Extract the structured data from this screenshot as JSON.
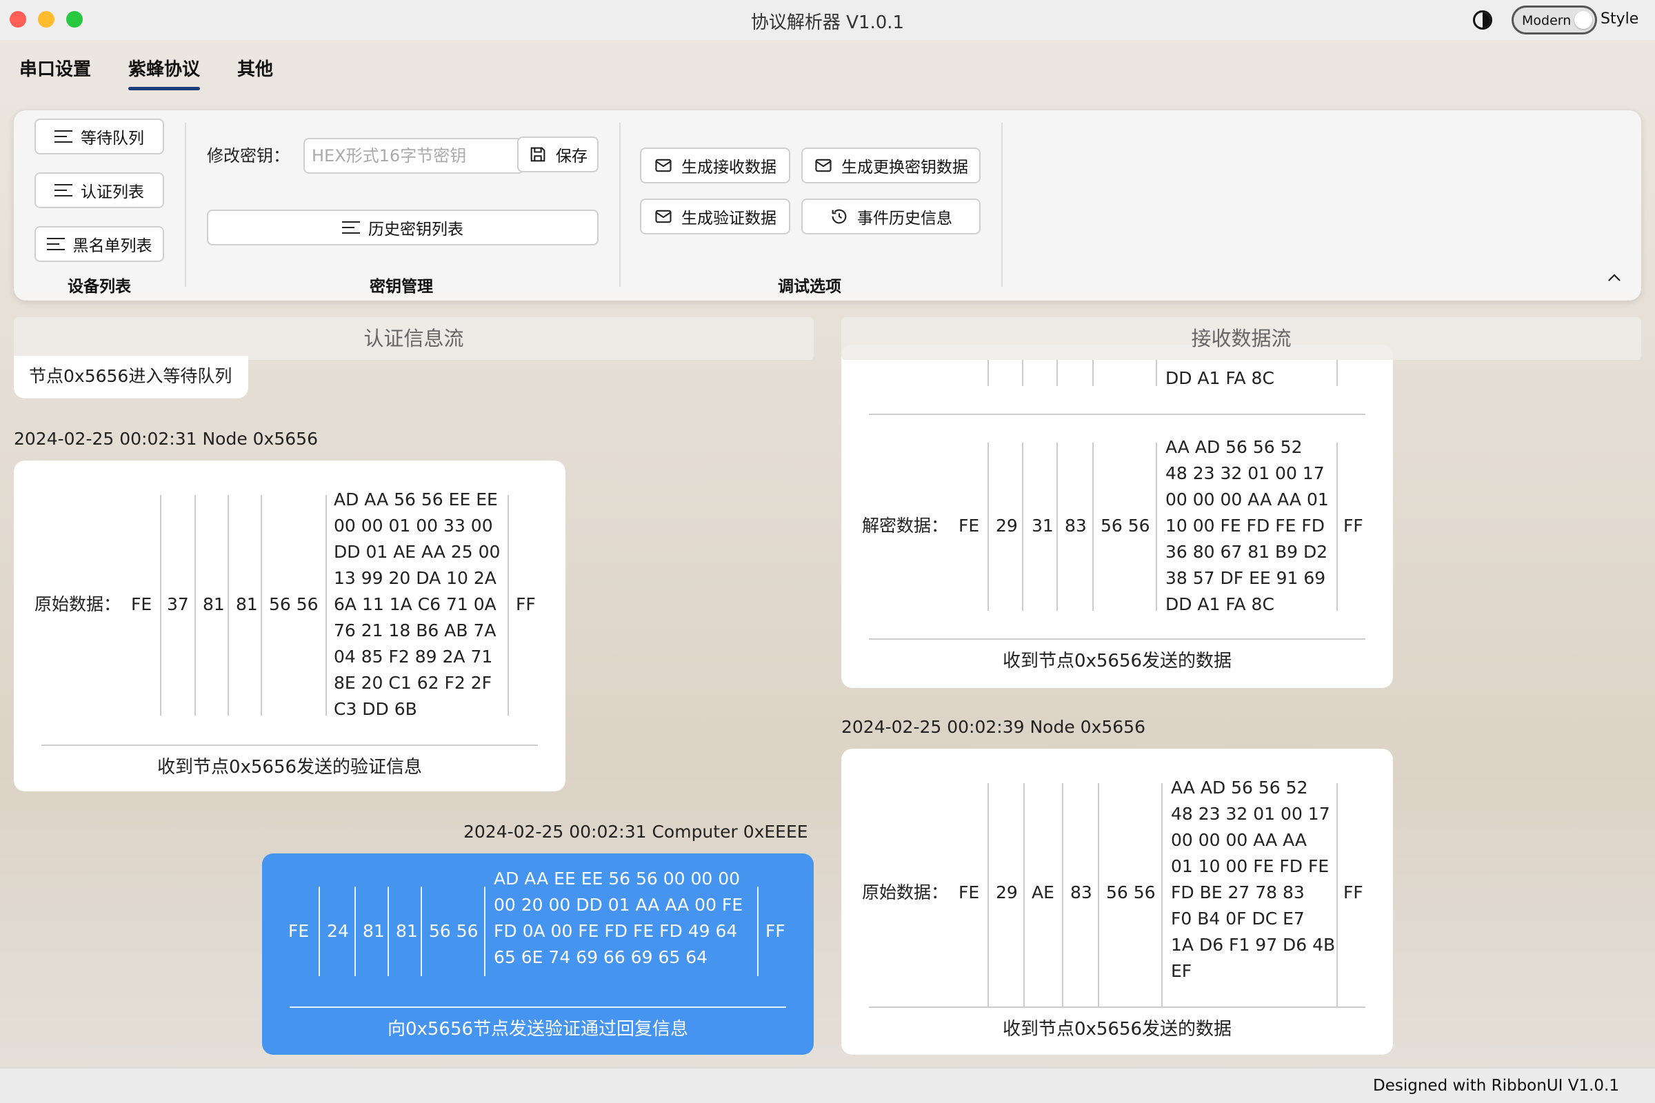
{
  "app": {
    "title": "协议解析器 V1.0.1",
    "style_toggle_label": "Modern",
    "style_label": "Style",
    "theme_icon": "contrast-icon"
  },
  "tabs": [
    "串口设置",
    "紫蜂协议",
    "其他"
  ],
  "ribbon": {
    "device_list": {
      "buttons": [
        "等待队列",
        "认证列表",
        "黑名单列表"
      ],
      "label": "设备列表"
    },
    "key_mgmt": {
      "modify_label": "修改密钥：",
      "key_placeholder": "HEX形式16字节密钥",
      "save_label": "保存",
      "history_button": "历史密钥列表",
      "label": "密钥管理"
    },
    "debug": {
      "buttons": [
        "生成接收数据",
        "生成更换密钥数据",
        "生成验证数据",
        "事件历史信息"
      ],
      "label": "调试选项"
    }
  },
  "auth_stream": {
    "header": "认证信息流",
    "notice": "节点0x5656进入等待队列",
    "items": [
      {
        "timestamp": "2024-02-25 00:02:31  Node 0x5656",
        "label": "原始数据：",
        "cells": [
          "FE",
          "37",
          "81",
          "81",
          "56 56"
        ],
        "payload": "AD AA 56 56 EE EE\n00 00 01 00 33 00\nDD 01 AE AA 25 00\n13 99 20 DA 10 2A\n6A 11 1A C6 71 0A\n76 21 18 B6 AB 7A\n04 85 F2 89 2A 71\n8E 20 C1 62 F2 2F\nC3 DD 6B",
        "tail": "FF",
        "caption": "收到节点0x5656发送的验证信息"
      },
      {
        "timestamp": "2024-02-25 00:02:31  Computer 0xEEEE",
        "cells": [
          "FE",
          "24",
          "81",
          "81",
          "56 56"
        ],
        "payload": "AD AA EE EE 56 56 00 00 00\n00 20 00 DD 01 AA AA 00 FE\nFD 0A 00 FE FD FE FD 49 64\n65 6E 74 69 66 69 65 64",
        "tail": "FF",
        "caption": "向0x5656节点发送验证通过回复信息"
      }
    ]
  },
  "recv_stream": {
    "header": "接收数据流",
    "partial_payload_line": "DD A1 FA 8C",
    "items": [
      {
        "label": "解密数据：",
        "cells": [
          "FE",
          "29",
          "31",
          "83",
          "56 56"
        ],
        "payload": "AA AD 56 56 52\n48 23 32 01 00 17\n00 00 00 AA AA 01\n10 00 FE FD FE FD\n36 80 67 81 B9 D2\n38 57 DF EE 91 69\nDD A1 FA 8C",
        "tail": "FF",
        "caption": "收到节点0x5656发送的数据"
      },
      {
        "timestamp": "2024-02-25 00:02:39  Node 0x5656",
        "label": "原始数据：",
        "cells": [
          "FE",
          "29",
          "AE",
          "83",
          "56 56"
        ],
        "payload": "AA AD 56 56 52\n48 23 32 01 00 17\n00 00 00 AA AA\n01 10 00 FE FD FE\nFD BE 27 78 83\nF0 B4 0F DC E7\n1A D6 F1 97 D6 4B\nEF",
        "tail": "FF",
        "caption": "收到节点0x5656发送的数据"
      }
    ]
  },
  "status": {
    "text": "Designed with RibbonUI V1.0.1"
  }
}
